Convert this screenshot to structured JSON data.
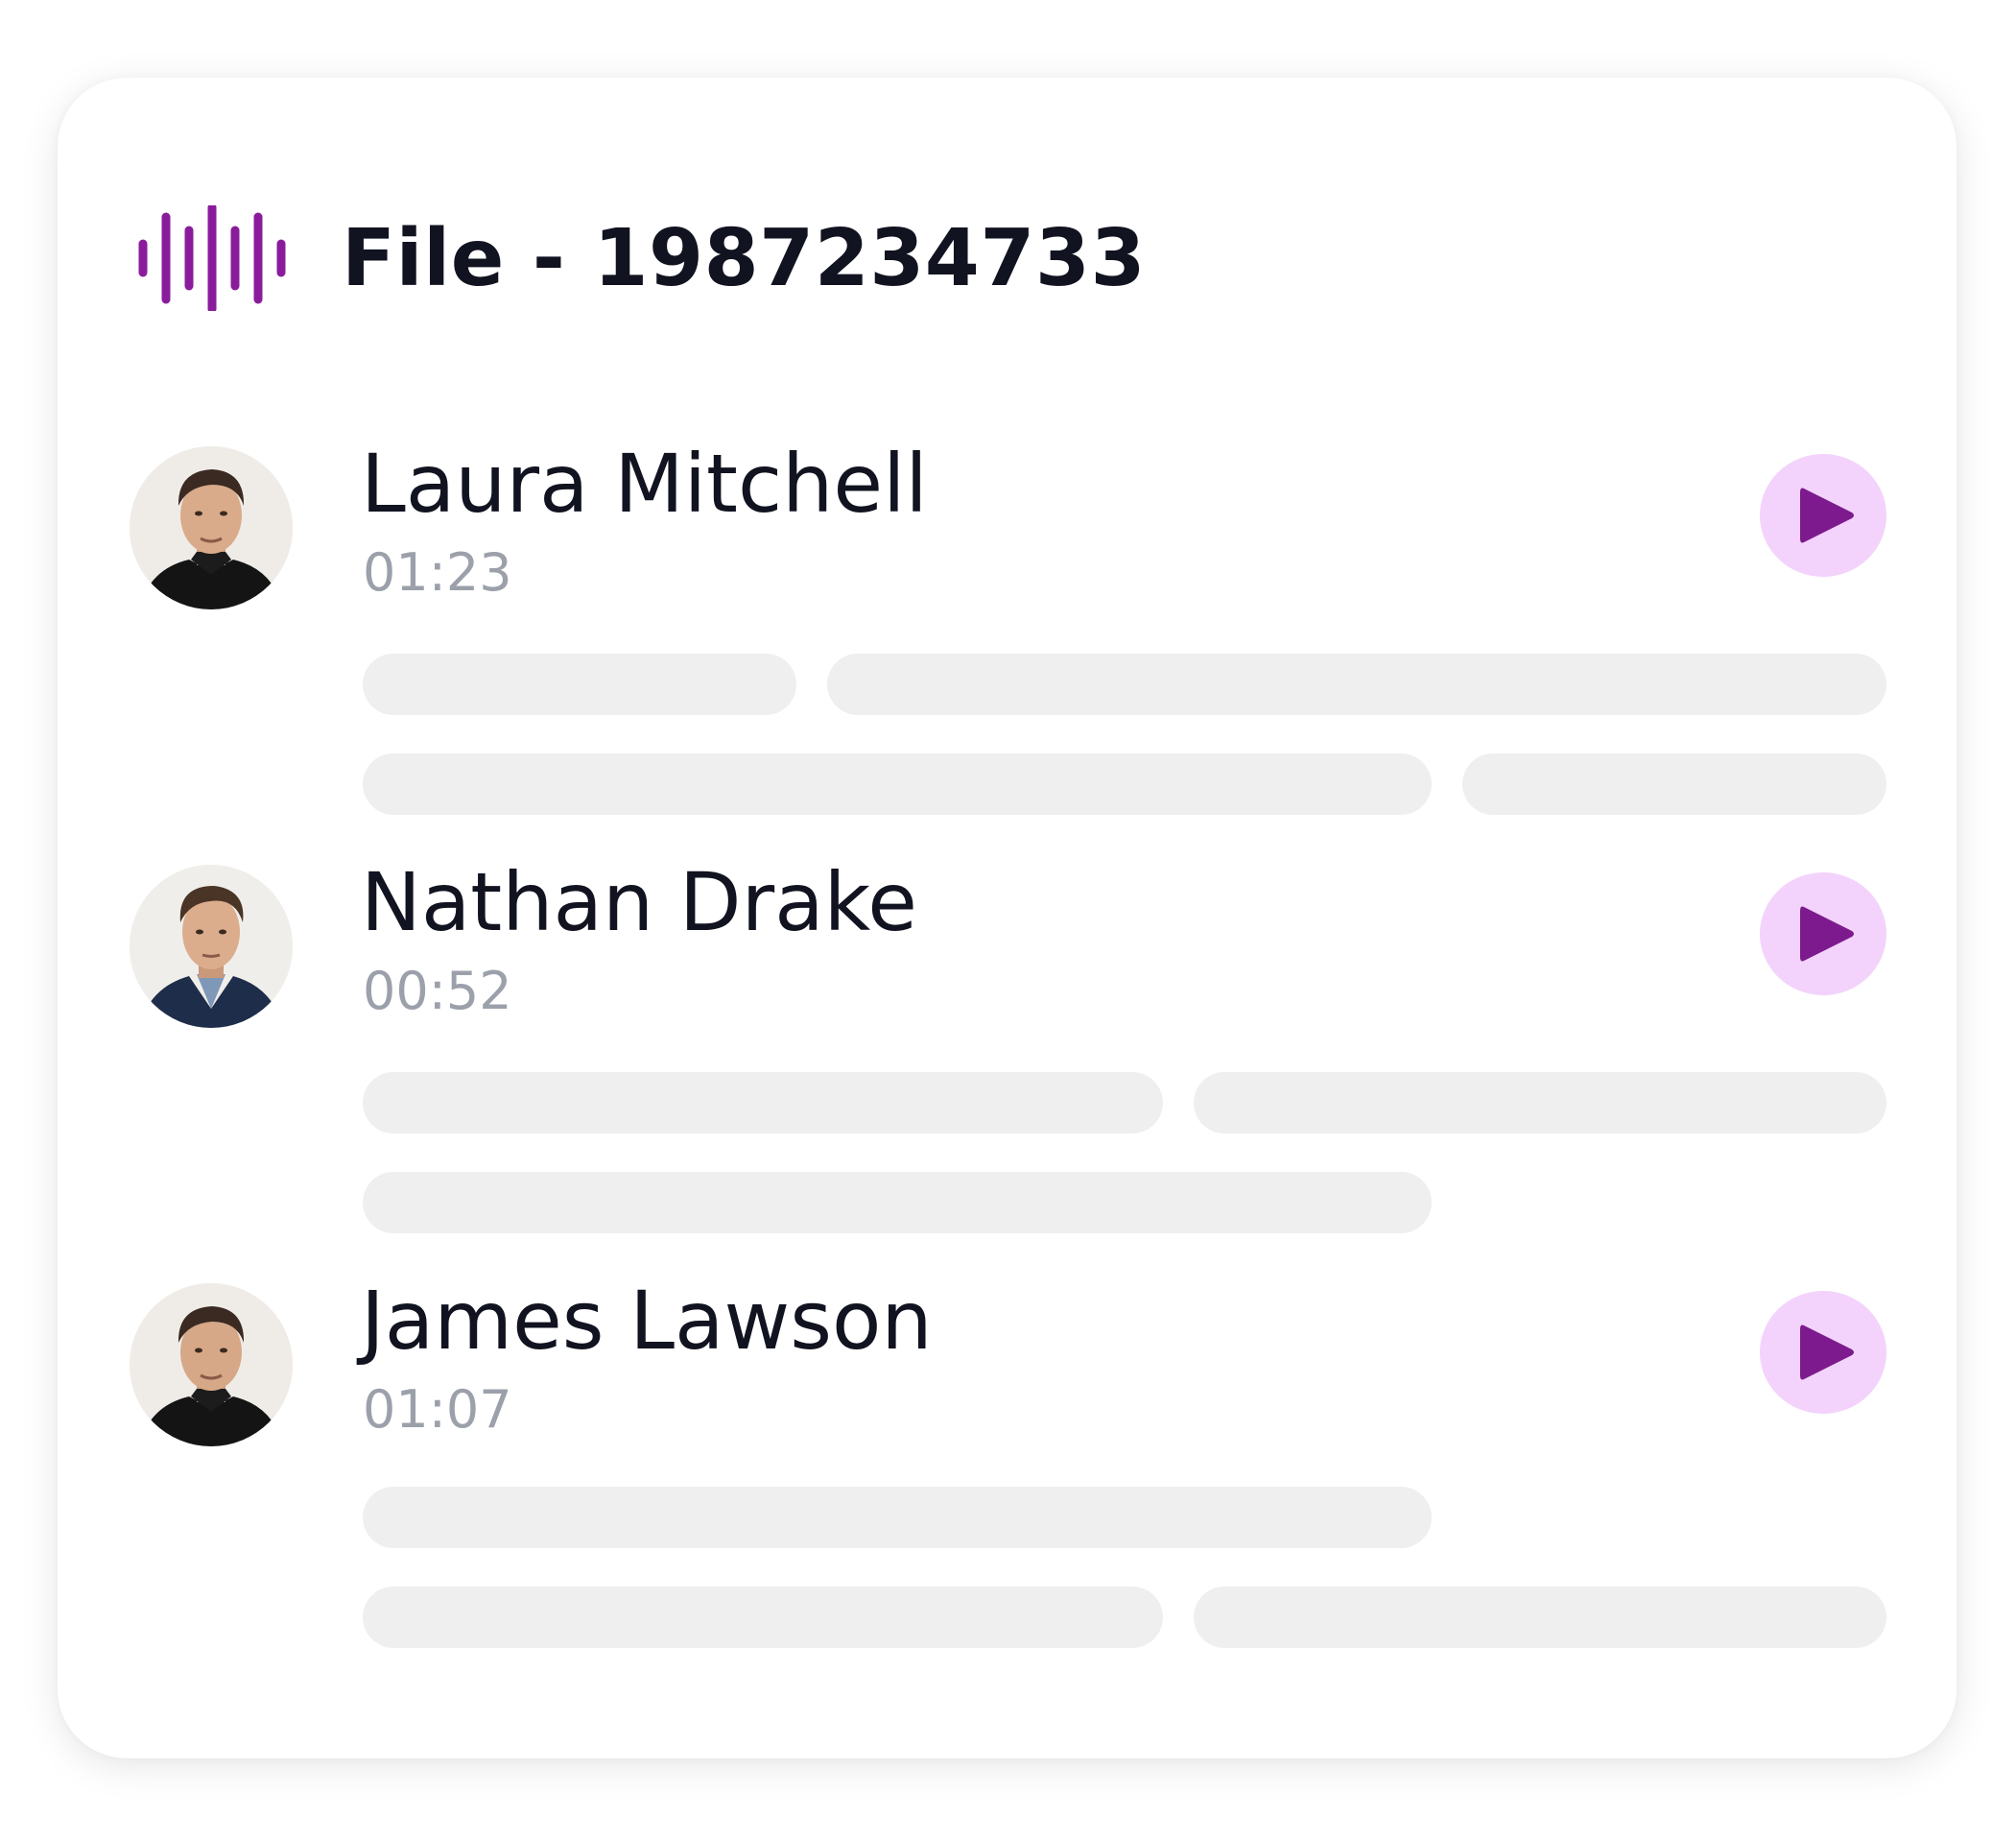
{
  "file": {
    "title": "File - 1987234733",
    "icon": "waveform-icon",
    "accent_color": "#8a1c9c"
  },
  "play_button": {
    "background": "#f3d3fb",
    "icon_color": "#7d1a8e",
    "icon": "play-icon"
  },
  "entries": [
    {
      "name": "Laura Mitchell",
      "duration": "01:23",
      "avatar_icon": "person-avatar"
    },
    {
      "name": "Nathan Drake",
      "duration": "00:52",
      "avatar_icon": "person-avatar"
    },
    {
      "name": "James Lawson",
      "duration": "01:07",
      "avatar_icon": "person-avatar"
    }
  ]
}
